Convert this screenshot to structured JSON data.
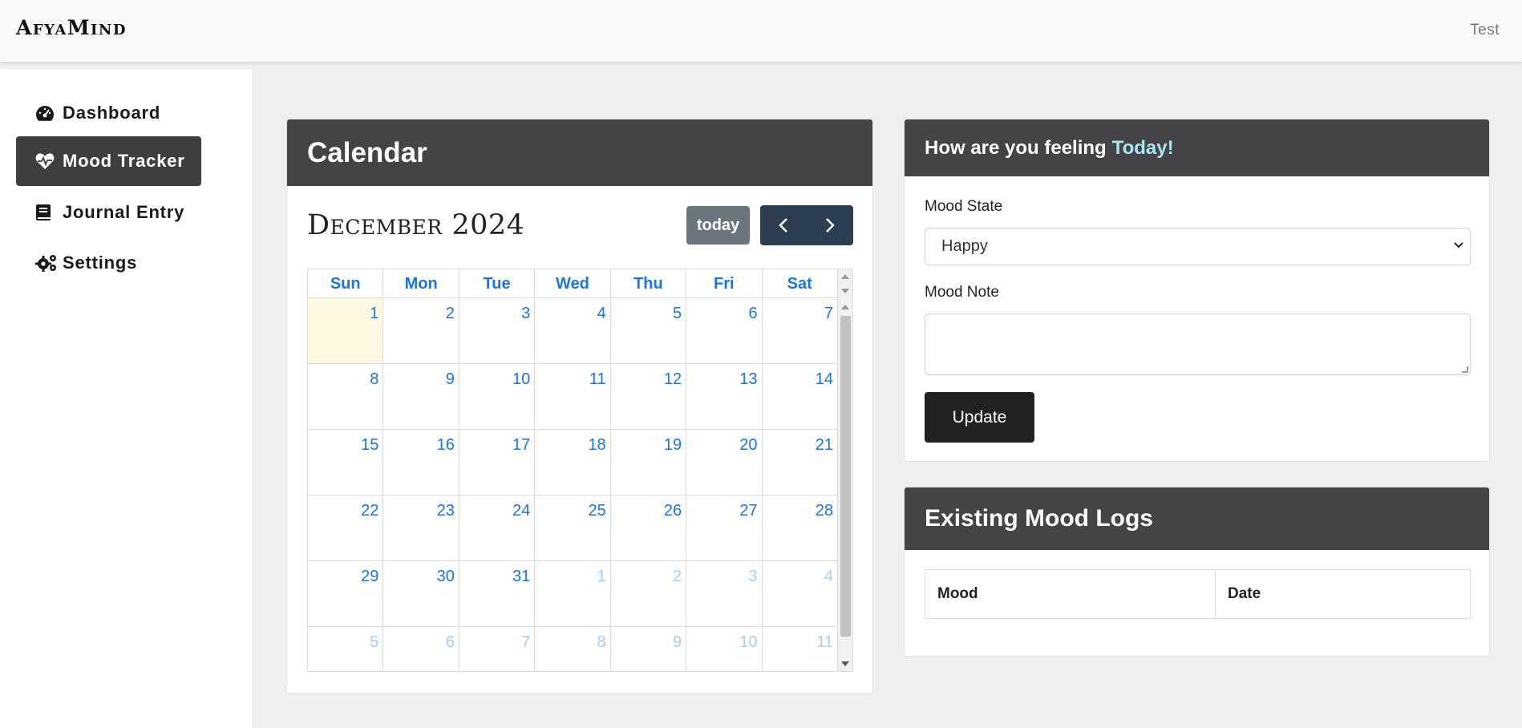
{
  "header": {
    "brand": "AfyaMind",
    "user": "Test"
  },
  "sidebar": {
    "items": [
      {
        "label": "Dashboard",
        "icon": "dashboard-gauge-icon"
      },
      {
        "label": "Mood Tracker",
        "icon": "heartbeat-icon",
        "active": true
      },
      {
        "label": "Journal Entry",
        "icon": "book-icon"
      },
      {
        "label": "Settings",
        "icon": "gears-icon"
      }
    ]
  },
  "calendar": {
    "card_title": "Calendar",
    "month_title": "December 2024",
    "today_label": "today",
    "prev_icon": "chevron-left-icon",
    "next_icon": "chevron-right-icon",
    "weekdays": [
      "Sun",
      "Mon",
      "Tue",
      "Wed",
      "Thu",
      "Fri",
      "Sat"
    ],
    "weeks": [
      [
        {
          "d": "1",
          "t": 1
        },
        {
          "d": "2"
        },
        {
          "d": "3"
        },
        {
          "d": "4"
        },
        {
          "d": "5"
        },
        {
          "d": "6"
        },
        {
          "d": "7"
        }
      ],
      [
        {
          "d": "8"
        },
        {
          "d": "9"
        },
        {
          "d": "10"
        },
        {
          "d": "11"
        },
        {
          "d": "12"
        },
        {
          "d": "13"
        },
        {
          "d": "14"
        }
      ],
      [
        {
          "d": "15"
        },
        {
          "d": "16"
        },
        {
          "d": "17"
        },
        {
          "d": "18"
        },
        {
          "d": "19"
        },
        {
          "d": "20"
        },
        {
          "d": "21"
        }
      ],
      [
        {
          "d": "22"
        },
        {
          "d": "23"
        },
        {
          "d": "24"
        },
        {
          "d": "25"
        },
        {
          "d": "26"
        },
        {
          "d": "27"
        },
        {
          "d": "28"
        }
      ],
      [
        {
          "d": "29"
        },
        {
          "d": "30"
        },
        {
          "d": "31"
        },
        {
          "d": "1",
          "o": 1
        },
        {
          "d": "2",
          "o": 1
        },
        {
          "d": "3",
          "o": 1
        },
        {
          "d": "4",
          "o": 1
        }
      ],
      [
        {
          "d": "5",
          "o": 1
        },
        {
          "d": "6",
          "o": 1
        },
        {
          "d": "7",
          "o": 1
        },
        {
          "d": "8",
          "o": 1
        },
        {
          "d": "9",
          "o": 1
        },
        {
          "d": "10",
          "o": 1
        },
        {
          "d": "11",
          "o": 1
        }
      ]
    ]
  },
  "mood_form": {
    "title_prefix": "How are you feeling",
    "title_accent": "Today!",
    "state_label": "Mood State",
    "state_value": "Happy",
    "note_label": "Mood Note",
    "note_value": "",
    "submit_label": "Update"
  },
  "mood_logs": {
    "title": "Existing Mood Logs",
    "columns": [
      "Mood",
      "Date"
    ]
  },
  "colors": {
    "header_dark": "#444446",
    "link_blue": "#1a73e8",
    "accent_cyan": "#a8e6f0",
    "today_highlight": "#fdf8e1",
    "nav_button": "#2c3e50"
  }
}
